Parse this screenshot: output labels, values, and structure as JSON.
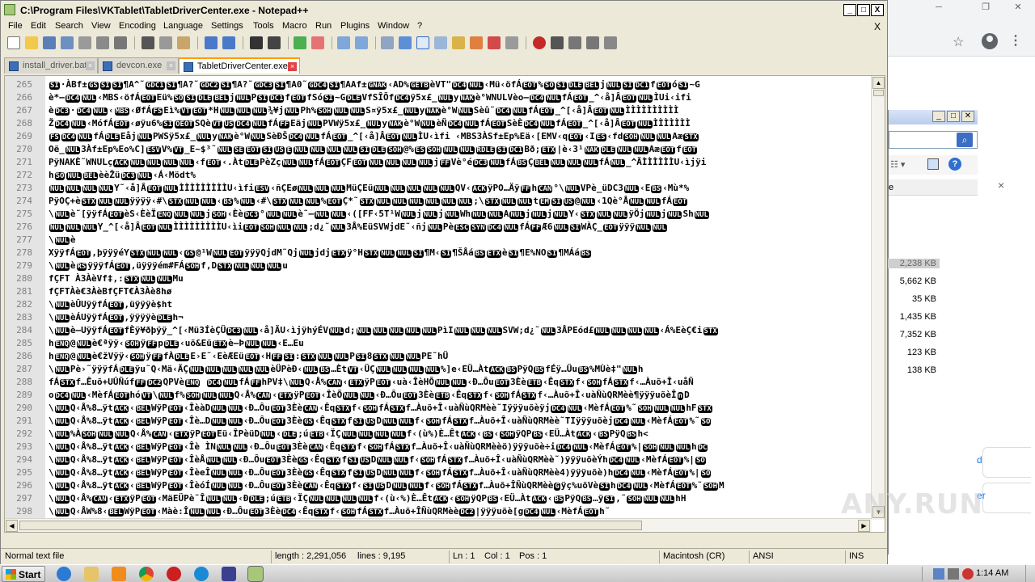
{
  "window": {
    "title": "C:\\Program Files\\VKTablet\\TabletDriverCenter.exe - Notepad++",
    "minimize": "_",
    "maximize": "□",
    "close": "X"
  },
  "menu": [
    "File",
    "Edit",
    "Search",
    "View",
    "Encoding",
    "Language",
    "Settings",
    "Tools",
    "Macro",
    "Run",
    "Plugins",
    "Window",
    "?"
  ],
  "menu_close": "X",
  "tabs": [
    {
      "label": "install_driver.bat",
      "close": "×"
    },
    {
      "label": "devcon.exe",
      "close": "×"
    },
    {
      "label": "TabletDriverCenter.exe",
      "close": "×"
    }
  ],
  "editor": {
    "lines": [
      {
        "num": "265",
        "text": "[SI]·ÀBf±[GS][SI][SI]¶A^˜[GDC1][SI]¶A?˜[GDC2][SI]¶A?˜[GDC3][SI]¶A0˜[GDC4][SI]¶AAf±[GNAK]‹AD%[GETB]èVT\"[DC4][NUL]‹Mü‹öfÁ[EOT]%[SO][SI][DLE][BEL]j[NUL][SI][DC1]f[EOT]ó[SI]~G"
      },
      {
        "num": "266",
        "text": "è*—[DC4][NUL]‹MBS‹öfÁ[EOT]Eü%[SO][SI][DLE][BEL]j[NUL]P[SI][DC1]f[EOT]fSó[SI]~G[DLE]VfSÎÕf[DC4]ÿ5x£_[NUL]y[NAK]è°WNULVèo—[DC4][NUL]fÁ[EOT]_^‹å]Â[EOT][NUL]ÌUi‹ifi"
      },
      {
        "num": "267",
        "text": "è[DC3]·[DC4][NUL]‹[MBS]‹ØfÁ[FS]Eì%[VT][EOT]*H[NUL][NUL][NUL]¾¥j[NUL]Ph%[SOH][NUL][NUL]S¤ÿ5x£_[NUL]y[NAK]è°W[NUL]Sèû˜[DC4][NUL]fÁ[EOT]_^[‹å]Â[EOT][NUL]ÌÌÌÌÌÌÌÌÌÌ"
      },
      {
        "num": "268",
        "text": "Ž[DC4][NUL]‹MófÁ[EOT]‹øÿu6%[SI][OEOT]SQè[VT][US][DC4][NUL]fÁ[FF]Eäj[NUL]PVWÿ5x£_[NUL]y[NAK]è°W[NUL]èÑ[DC4][NUL]fÁ[EOT]SèÈ[DC4][NUL]fÁ[EOT]_^[‹å]Â[EOT][NUL]ÌÌÌÌÌÌÌ"
      },
      {
        "num": "269",
        "text": "[FS][DC4][NUL]fÁ[DLE]Eåj[NUL]PWSÿ5x£_[NUL]y[NAK]è°W[NUL]SèÐŠ[DC4][NUL]fÁ[EOT]_^[‹å]Â[EOT][NUL]ÌU‹ìfi ‹MBS3ÀSf±Ep%Eä‹[EMV‹q[EOT]‹I[ES]‹fd[SOH][NUL][NUL]Aæ[STX]"
      },
      {
        "num": "270",
        "text": "Oë_[NUL]3Àf±Ep%Eo%C][ESV]V%[VT]_E~$³˜[NUL][SE][EOT][SI][US][E][NUL][NUL][NUL][NUL][SI][DLE][SOH]@%[ES][SOH][NUL][NUL][RDLE][SI][DC1]Bð;[ETX]|è‹3¹[NAK][DLE][NUL][NUL]Aæ[EOT]f[EOT]"
      },
      {
        "num": "271",
        "text": "PÿNAKÈ˜WNULç[ACK][NUL][NUL][NUL][NUL]‹f[EOT]‹.Àt[DLE]PèZç[NUL][NUL]fÁ[EOT]ÇF[EOT][NUL][NUL][NUL][NUL]j[FF]Vè°é[DC3][NUL]fÁ[BS]Ç[BEL][NUL][NUL][NUL]fÁ[NUL]_^ÃÌÌÌÌÌÌU‹ìjÿi"
      },
      {
        "num": "272",
        "text": "h[SO][NUL][BEL]èèŽü[DC3][NUL]‹Á‹Mödt%"
      },
      {
        "num": "273",
        "text": "[NUL][NUL][NUL][NUL]Y˜‹å]Â[EOT][NUL]ÌÌÌÌÌÌÌÌÌU‹ìfi[ESV]‹ñÇEø[NUL][NUL][NUL]MüÇEü[NUL][NUL][NUL][NUL][NUL]QV‹[ACK]ÿPO…Äÿ[FF]h[CAN]°\\[NUL]VPè_üDC3[NUL]‹E[BS]‹Mù*%"
      },
      {
        "num": "274",
        "text": "PÿOÇ+è[STX][NUL][NUL]ÿÿÿÿ‹#\\[STX][NUL][NUL]‹[BS]%[NUL]‹#\\[STX][NUL][NUL]%[EOT]Ç*˜[STX][NUL][NUL][NUL][NUL][NUL][NUL];\\[STX][NUL][NUL]t[EM][SI][US]@[NUL]‹1Qè°Å[NUL][NUL]fÁ[EOT]"
      },
      {
        "num": "275",
        "text": "\\[NUL]è˜[ÿÿfÁ[EOT]èS‹ÈèÏ[ENQ][NUL][NUL]j[SOH]‹Èè[DC3]°[NUL][NUL]è˜—[NUL][NUL]‹([FF‹5T¹W[NUL]j[NUL]j[NUL]Wh[NUL][NUL]A[NUL]j[NUL]j[NUL]Y‹[STX][NUL][NUL]ÿÖj[NUL]j[NUL]Sh[NUL]"
      },
      {
        "num": "276",
        "text": "[NUL][NUL][NUL]Y_^[‹å]Â[EOT][NUL]ÌÌÌÌÌÌÌÌÌU‹ìi[EOT][SOH][NUL][NUL];d¿˜[NUL]3Å%EüSVWjdE˜‹ñj[NUL]Pè[ESC][SYN][DC4][NUL]fÁ[FF]Æ6[NUL][SI]WÀÇ_[EOT]ÿÿÿ[NUL][NUL]"
      },
      {
        "num": "277",
        "text": "\\[NUL]è"
      },
      {
        "num": "278",
        "text": "XÿÿfÁ[EOT],þÿÿÿéY[STX][NUL][NUL]‹[GS]@¹W[NUL][EOT]ÿÿÿQjdM˜Qj[NUL]jdj[ETX]ÿ°H[STX][NUL][NUL][SI]¶M‹[SI]¶ŠÅá[BS][ETX]è[SI]¶E%NO[SI]¶MÁá[BS]"
      },
      {
        "num": "279",
        "text": "\\[NUL]è[RS]ÿÿÿfÁ[EOT],üÿÿÿém#FÁ[SOH]f,D[STX][NUL][NUL][NUL]u"
      },
      {
        "num": "280",
        "text": "fÇFT À3ÀèVf‡,:[STX][NUL][NUL]Mu"
      },
      {
        "num": "281",
        "text": "fÇFTÀè€3ÀèBfÇFT€À3Àè8hø"
      },
      {
        "num": "282",
        "text": "\\[NUL]èÛUÿÿfÁ[EOT],üÿÿÿè$ht"
      },
      {
        "num": "283",
        "text": "\\[NUL]èÁUÿÿfÁ[EOT],ÿÿÿÿè[DLE]h¬"
      },
      {
        "num": "284",
        "text": "\\[NUL]è–UÿÿfÁ[EOT]fÈÿ¥ðþÿÿ_^[‹Mü3ÍèÇÜ[DC3][NUL]‹å]ÃU‹ìjÿhýÉV[NUL]d;[NUL][NUL][NUL][NUL][NUL]PìI[NUL][NUL][NUL]SVW;d¿˜[NUL]3ÅPEód£[NUL][NUL][NUL][NUL]‹Á%EèÇ€i[STX]"
      },
      {
        "num": "285",
        "text": "h[ENQ]@[NUL]è€ªÿÿ‹[SOH]ÿ[FF]p[DLE]‹uõ&Eü[ETX]è–Þ[NUL][NUL]‹E…Eu"
      },
      {
        "num": "286",
        "text": "h[ENQ]@[NUL]è€žVÿÿ‹[SOH]ÿ[FF]fÀ[DLE]E›E˜‹EèÆEü[EOT]‹H[FF][SI]:[STX][NUL][NUL]P[SI]8[STX][NUL][NUL]PE˜hÜ"
      },
      {
        "num": "287",
        "text": "\\[NUL]Pè›˜ÿÿÿfÁ[DLE]ÿu˜Q‹Mä‹ÄÇ[NUL][NUL][NUL][NUL][NUL]èÜPèÐ‹[NUL][BS]…Èt[VT]‹ÜÇ[NUL][NUL][NUL][NUL]%]e‹EÜ…Àt[ACK][BS]PÿQ[BS]fÉÿ…Üu[BS]%MÙè‡\"[NUL]h"
      },
      {
        "num": "288",
        "text": "fÁ[STX]f…Êuõ+UÛÑúf[FF][DC2]QPVè[ENQ]   [DC4][NUL]fÁ[FF]hPV‡\\[NUL]Q‹Å%[CAN]‹[ETX]ÿP[EOT]‹uà‹ÎèHÕ[NUL][NUL]‹Ð…Ôu[EOT]3Èè[ETB]‹Êq[STX]f‹[SOH]fÁ[STX]f‹…Àuõ+Î‹uåÑ"
      },
      {
        "num": "289",
        "text": "o[DC4][NUL]‹MèfÁ[EOT]hó[VT]\\[NUL]f%[SOH][NUL][NUL]Q‹Å%[CAN]‹[ETX]ÿP[EOT]‹ÎèÕ[NUL][NUL]‹Ð…Ôu[EOT]3Èè[ETB]‹Êq[STX]f‹[SOH]fÁ[STX]f‹…Àuõ+Î‹uàÑùQRMèè¶ÿÿÿuõèÎ[n]D"
      },
      {
        "num": "290",
        "text": "\\[NUL]Q‹Å%8…ÿt[ACK]‹[BEL]WÿP[EOT]‹ÎèàD[NUL][NUL]‹Ð…Ôu[EOT]3Èè[CAN]‹Êq[STX]f‹[SOH]fÁ[STX]f…Àuõ+Î‹uàÑùQRMèè˜Iÿÿÿuõèÿj[DC4][NUL]‹MèfÁ[EOT]%˜[SOH][NUL][NUL]hF[STX]"
      },
      {
        "num": "291",
        "text": "\\[NUL]Q‹Å%8…ÿt[ACK]‹[BEL]WÿP[EOT]‹Îè…D[NUL][NUL]‹Ð…Ôu[EOT]3Èè[GS]‹Êq[STX]f[SI][US]D[NUL][NUL]f‹[SOH]fÁ[STX]f…Àuõ+Î‹uàÑùQRMèè˜TIÿÿÿuõèj[DC4][NUL]‹MèfÁ[EOT]%˜[SO]"
      },
      {
        "num": "292",
        "text": "\\[NUL]%À[SOH][NUL][NUL]Q‹Å%[CAN]‹[ETX]ÿP[EOT]Eü‹ÎPèüD[NUL]‹[DLE];ú[ETB]‹ÏÇ[NUL][NUL][NUL][NUL]f‹(ù%)È…Êt[ACK]‹[BS]‹[SOH]ÿQP[BS]‹EÜ…Àt[ACK]‹[BS]PÿQ[BS]h<"
      },
      {
        "num": "293",
        "text": "\\[NUL]Q‹Å%8…ÿt[ACK]‹[BEL]WÿP[EOT]‹Îè ÌN[NUL][NUL]‹Ð…Ôu[EOT]3Èè[CAN]‹Êq[STX]f‹[SOH]fÁ[STX]f…Àuõ+Î‹uàÑùQRMèèö)ÿÿÿuõè÷i[DC4][NUL]‹MèfÁ[EOT]%|[SOH][NUL][NUL]h[DC]"
      },
      {
        "num": "294",
        "text": "\\[NUL]Q‹Å%8…ÿt[ACK]‹[BEL]WÿP[EOT]‹ÎèÅ[NUL][NUL]‹Ð…Ôu[EOT]3Èè[GS]‹Êq[STX]f[SI][US]D[NUL][NUL]f‹[SOH]fÁ[STX]f…Àuõ+Î‹uàÑùQRMèè˜)ÿÿÿuõèÝh[DC4][NUL]‹MèfÁ[EOT]%|[SO]"
      },
      {
        "num": "295",
        "text": "\\[NUL]Q‹Å%8…ÿt[ACK]‹[BEL]WÿP[EOT]‹ÎèeÎ[NUL][NUL]‹Ð…Ôu[EOT]3Èè[GS]‹Êq[STX]f[SI][US]D[NUL][NUL]f‹[SOH]fÁ[STX]f…Àuõ+Î‹uàÑùQRMèè4)ÿÿÿuõè)h[DC4][NUL]‹MèfÁ[EOT]%|[SO]"
      },
      {
        "num": "296",
        "text": "\\[NUL]Q‹Å%8…ÿt[ACK]‹[BEL]WÿP[EOT]‹ÎèóÍ[NUL][NUL]‹Ð…Ôu[EOT]3Èè[CAN]‹Êq[STX]f‹[SI][US]D[NUL][NUL]f‹[SOH]fÁ[STX]f…Àuõ+ÎÑùQRMèè[G]ÿç%uõVè[SI]h[DC4][NUL]‹MèfÁ[EOT]%˜[SOH]M"
      },
      {
        "num": "297",
        "text": "\\[NUL]Q‹Å%[CAN]‹[ETX]ÿP[EOT]‹MäEÜPè˜Î[NUL][NUL]‹Ð[DLE];ú[ETB]‹ÏÇ[NUL][NUL][NUL][NUL]f‹(ù‹%)È…Êt[ACK]‹[SOH]ÿQP[BS]‹EÜ…Àt[ACK]‹[BS]PÿQ[BS]…ÿ[SI],˜[SOH][NUL][NUL]hH"
      },
      {
        "num": "298",
        "text": "\\[NUL]Q‹ÅW%8‹[BEL]WÿP[EOT]‹Màè:Î[NUL][NUL]‹Ð…Ôu[EOT]3Èè[DC4]‹Êq[STX]f‹[SOH]fÁ[STX]f…Àuõ+ÎÑùQRMèè[DC2]|ÿÿÿuõè[g[DC4][NUL]‹MèfÁ[EOT]h˜"
      },
      {
        "num": "299",
        "text": "\\[NUL]%À[SOH][NUL][NUL]Q‹ÅW%8‹[BEL]WÿP[EOT]‹MàèæÎ[NUL][NUL]‹Ð…Ôu[EOT]3Èè[ESC]‹Êq[STX]f[SI][US]D[NUL][NUL]f‹[SOH]fÁ[STX]f…Àuõ+ÎÑùQRMèè·(ÿÿÿuõè¤±[DC4][NUL]"
      }
    ]
  },
  "statusbar": {
    "type": "Normal text file",
    "length": "length : 2,291,056",
    "lines": "lines : 9,195",
    "ln": "Ln : 1",
    "col": "Col : 1",
    "pos": "Pos : 1",
    "eol": "Macintosh (CR)",
    "encoding": "ANSI",
    "mode": "INS"
  },
  "explorer": {
    "header_label": "e",
    "sizes": [
      "2,238 KB",
      "5,662 KB",
      "35 KB",
      "1,435 KB",
      "7,352 KB",
      "123 KB",
      "138 KB"
    ],
    "selected_index": 0
  },
  "browser": {
    "link_1": "d",
    "link_2": "er",
    "close": "×"
  },
  "taskbar": {
    "start": "Start",
    "clock": "1:14 AM"
  },
  "watermark": "ANY.RUN",
  "colors": {
    "active_tab_accent": "#ff9c00",
    "ctrl_char_bg": "#000000",
    "gutter_bg": "#e4e4e4"
  }
}
